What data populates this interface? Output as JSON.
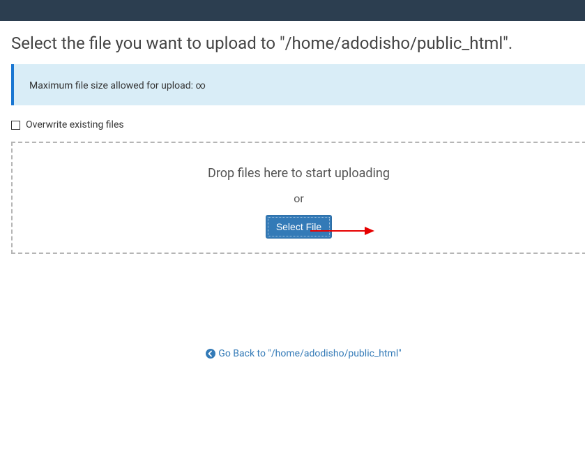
{
  "header": {
    "title": "Select the file you want to upload to \"/home/adodisho/public_html\"."
  },
  "info": {
    "message": "Maximum file size allowed for upload: ∞"
  },
  "overwrite": {
    "label": "Overwrite existing files"
  },
  "dropzone": {
    "drop_text": "Drop files here to start uploading",
    "or_text": "or",
    "button_label": "Select File"
  },
  "footer": {
    "back_link": "Go Back to \"/home/adodisho/public_html\""
  }
}
